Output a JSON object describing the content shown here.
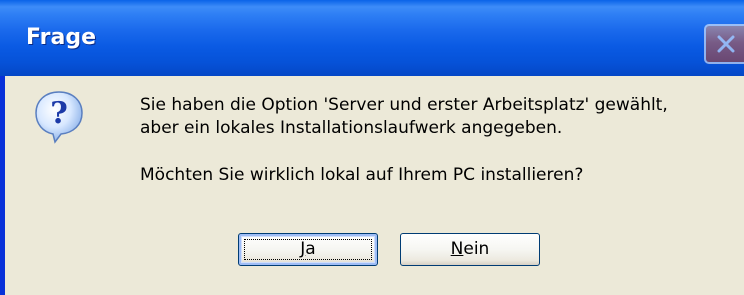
{
  "dialog": {
    "title": "Frage",
    "icon": "question-icon",
    "icon_glyph": "?",
    "message_lines": [
      "Sie haben die Option 'Server und erster Arbeitsplatz' gewählt,",
      "aber ein lokales Installationslaufwerk angegeben."
    ],
    "question": "Möchten Sie wirklich lokal auf Ihrem PC installieren?",
    "buttons": {
      "yes": {
        "mnemonic": "J",
        "rest": "a",
        "focused": true
      },
      "no": {
        "mnemonic": "N",
        "rest": "ein"
      }
    }
  },
  "colors": {
    "titlebar": "#0a5ae3",
    "client_background": "#ece9d8",
    "close_button": "#cf5b3a",
    "icon_bubble": "#cfe4ff",
    "icon_glyph": "#1c3aa8"
  }
}
